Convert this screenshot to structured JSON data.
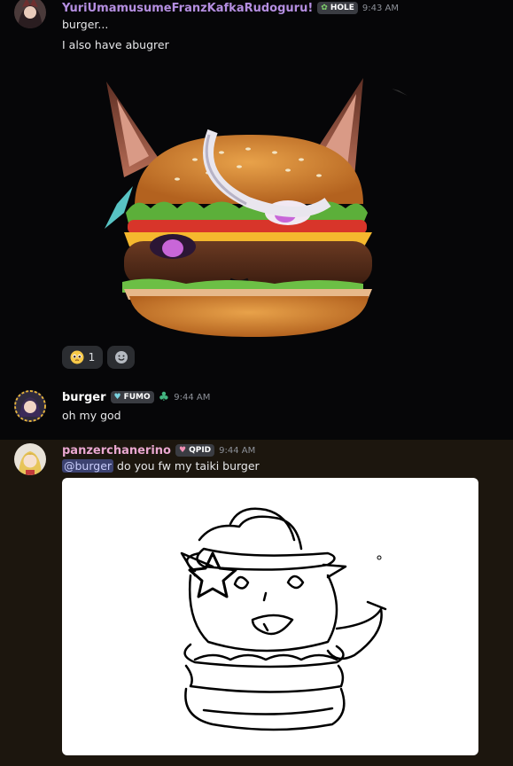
{
  "messages": [
    {
      "author": "YuriUmamusumeFranzKafkaRudoguru!",
      "author_color": "#b48ee0",
      "tag": {
        "icon": "leaf-icon",
        "label": "HOLE"
      },
      "time": "9:43 AM",
      "lines": [
        "burger...",
        "I also have  abugrer"
      ],
      "attachment": "burger-horse-image",
      "reactions": [
        {
          "emoji": "pleading-face-icon",
          "count": "1"
        },
        {
          "emoji": "add-reaction-icon",
          "count": ""
        }
      ]
    },
    {
      "author": "burger",
      "author_color": "#ffffff",
      "tag": {
        "icon": "fumo-icon",
        "label": "FUMO"
      },
      "extra_icon": "clover-icon",
      "time": "9:44 AM",
      "lines": [
        "oh my god"
      ]
    },
    {
      "author": "panzerchanerino",
      "author_color": "#e9a7d0",
      "tag": {
        "icon": "heart-icon",
        "label": "QPID"
      },
      "time": "9:44 AM",
      "mention": "@burger",
      "text": " do you fw my taiki burger",
      "attachment": "taiki-burger-sketch"
    }
  ]
}
